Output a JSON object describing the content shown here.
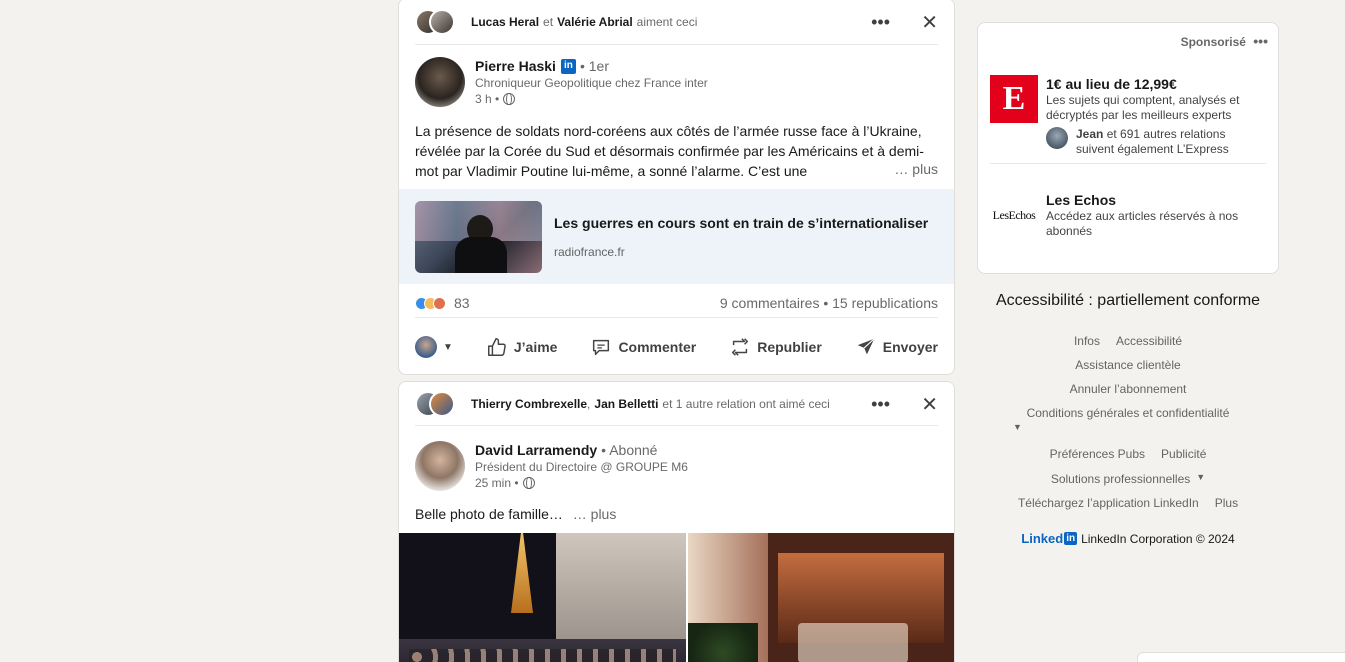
{
  "post1": {
    "social": {
      "name1": "Lucas Heral",
      "connector": "et",
      "name2": "Valérie Abrial",
      "suffix": "aiment ceci"
    },
    "actor": {
      "name": "Pierre Haski",
      "degree": "• 1er",
      "headline": "Chroniqueur Geopolitique chez France inter",
      "time": "3 h •"
    },
    "text": "La présence de soldats nord-coréens aux côtés de l’armée russe face à l’Ukraine, révélée par la Corée du Sud et désormais confirmée par les Américains et à demi-mot par Vladimir Poutine lui-même, a sonné l’alarme. C’est une",
    "more": "… plus",
    "link": {
      "title": "Les guerres en cours sont en train de s’internationaliser",
      "source": "radiofrance.fr"
    },
    "reactions_count": "83",
    "comments": "9 commentaires",
    "separator": "•",
    "reposts": "15 republications",
    "actions": {
      "like": "J’aime",
      "comment": "Commenter",
      "repost": "Republier",
      "send": "Envoyer"
    }
  },
  "post2": {
    "social": {
      "name1": "Thierry Combrexelle",
      "sep": ",",
      "name2": "Jan Belletti",
      "suffix": "et 1 autre relation ont aimé ceci"
    },
    "actor": {
      "name": "David Larramendy",
      "follow": "• Abonné",
      "headline": "Président du Directoire @ GROUPE M6",
      "time": "25 min •"
    },
    "text": "Belle photo de famille…",
    "more": "… plus"
  },
  "ads": {
    "sponsored": "Sponsorisé",
    "items": [
      {
        "logo_text": "E",
        "title": "1€ au lieu de 12,99€",
        "desc": "Les sujets qui comptent, analysés et décryptés par les meilleurs experts",
        "social_name": "Jean",
        "social_rest": "et 691 autres relations suivent également L’Express"
      },
      {
        "logo_text": "LesEchos",
        "title": "Les Echos",
        "desc": "Accédez aux articles réservés à nos abonnés"
      }
    ]
  },
  "footer": {
    "accessibility": "Accessibilité : partiellement conforme",
    "links": {
      "infos": "Infos",
      "accessibilite": "Accessibilité",
      "assistance": "Assistance clientèle",
      "annuler": "Annuler l’abonnement",
      "conditions": "Conditions générales et confidentialité",
      "prefs": "Préférences Pubs",
      "publicite": "Publicité",
      "solutions": "Solutions professionnelles",
      "telecharger": "Téléchargez l’application LinkedIn",
      "plus": "Plus"
    },
    "brand": "Linked",
    "brand_in": "in",
    "copyright": "LinkedIn Corporation © 2024"
  },
  "colors": {
    "accent": "#0a66c2",
    "background": "#f4f2ee",
    "link_card": "#edf3f8",
    "express_red": "#e2001a"
  }
}
